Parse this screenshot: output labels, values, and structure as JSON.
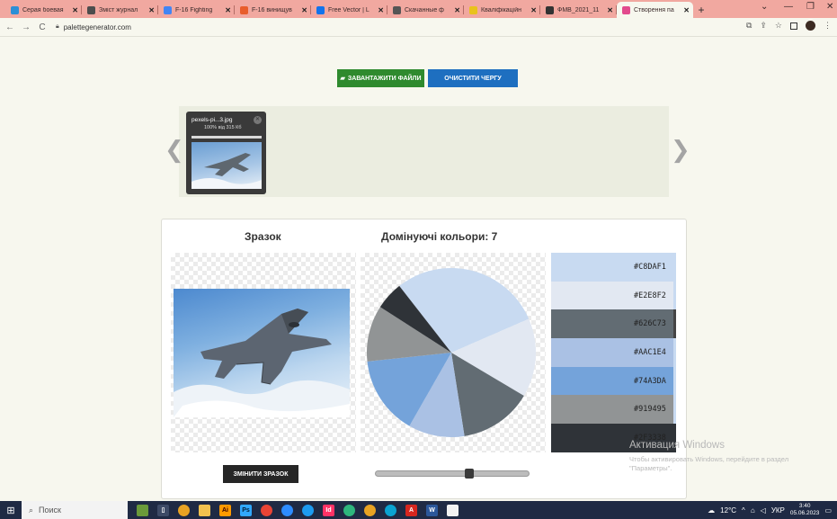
{
  "browser": {
    "tabs": [
      {
        "label": "Серая боевая",
        "favicon": "square-icon",
        "color": "#2b8fd6",
        "active": false
      },
      {
        "label": "Зміст журнал",
        "favicon": "globe-icon",
        "color": "#4d4d4d",
        "active": false
      },
      {
        "label": "F-16 Fighting",
        "favicon": "google-icon",
        "color": "#4285f4",
        "active": false
      },
      {
        "label": "F-16 винищув",
        "favicon": "square-icon",
        "color": "#e85d2b",
        "active": false
      },
      {
        "label": "Free Vector | L",
        "favicon": "freepik-icon",
        "color": "#1273eb",
        "active": false
      },
      {
        "label": "Скачанные ф",
        "favicon": "download-icon",
        "color": "#555555",
        "active": false
      },
      {
        "label": "Кваліфікаційн",
        "favicon": "square-icon",
        "color": "#e9c21c",
        "active": false
      },
      {
        "label": "ФМВ_2021_11",
        "favicon": "doc-icon",
        "color": "#333333",
        "active": false
      },
      {
        "label": "Створення па",
        "favicon": "palette-icon",
        "color": "#e24a8d",
        "active": true
      }
    ],
    "new_tab": "+",
    "url": "palettegenerator.com"
  },
  "toolbar": {
    "upload_label": "ЗАВАНТАЖИТИ ФАЙЛИ",
    "clear_label": "ОЧИСТИТИ ЧЕРГУ"
  },
  "queue": {
    "file_name": "pexels-pi...3.jpg",
    "file_size": "100% від 315 Кб",
    "progress": 1.0
  },
  "main": {
    "sample_title": "Зразок",
    "dominant_title": "Домінуючі кольори: 7",
    "change_label": "ЗМІНИТИ ЗРАЗОК",
    "slider_value": 0.62
  },
  "palette": [
    {
      "hex": "#C8DAF1"
    },
    {
      "hex": "#E2E8F2"
    },
    {
      "hex": "#626C73"
    },
    {
      "hex": "#AAC1E4"
    },
    {
      "hex": "#74A3DA"
    },
    {
      "hex": "#919495"
    },
    {
      "hex": "#2F3338"
    }
  ],
  "pie_segments": [
    {
      "color": "#C8DAF1",
      "share": 0.27
    },
    {
      "color": "#E2E8F2",
      "share": 0.14
    },
    {
      "color": "#626C73",
      "share": 0.13
    },
    {
      "color": "#AAC1E4",
      "share": 0.1
    },
    {
      "color": "#74A3DA",
      "share": 0.14
    },
    {
      "color": "#919495",
      "share": 0.1
    },
    {
      "color": "#2F3338",
      "share": 0.05
    }
  ],
  "windows_activation": {
    "title": "Активация Windows",
    "text": "Чтобы активировать Windows, перейдите в раздел \"Параметры\"."
  },
  "taskbar": {
    "search_placeholder": "Поиск",
    "temperature": "12°C",
    "lang": "УКР",
    "time": "3:40",
    "date": "05.06.2023"
  }
}
